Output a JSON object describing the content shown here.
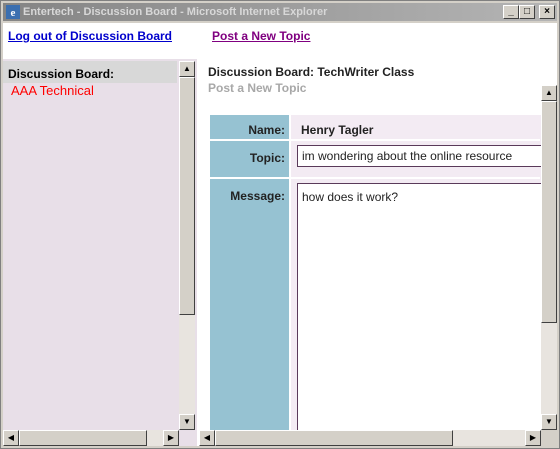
{
  "window": {
    "title": "Entertech - Discussion Board - Microsoft Internet Explorer",
    "icon": "ie-icon",
    "controls": [
      "minimize",
      "maximize",
      "close"
    ]
  },
  "nav": {
    "logout_label": "Log out of Discussion Board",
    "post_label": "Post a New Topic"
  },
  "left": {
    "heading": "Discussion Board:",
    "board_name": "AAA Technical"
  },
  "main": {
    "board_title": "Discussion Board: TechWriter Class",
    "subtitle": "Post a New Topic",
    "form": {
      "name_label": "Name:",
      "name_value": "Henry Tagler",
      "topic_label": "Topic:",
      "topic_value": "im wondering about the online resource",
      "message_label": "Message:",
      "message_value": "how does it work?"
    }
  },
  "colors": {
    "label_column": "#96c2d2",
    "left_frame": "#e8dfe8",
    "board_link": "#ff0000"
  }
}
